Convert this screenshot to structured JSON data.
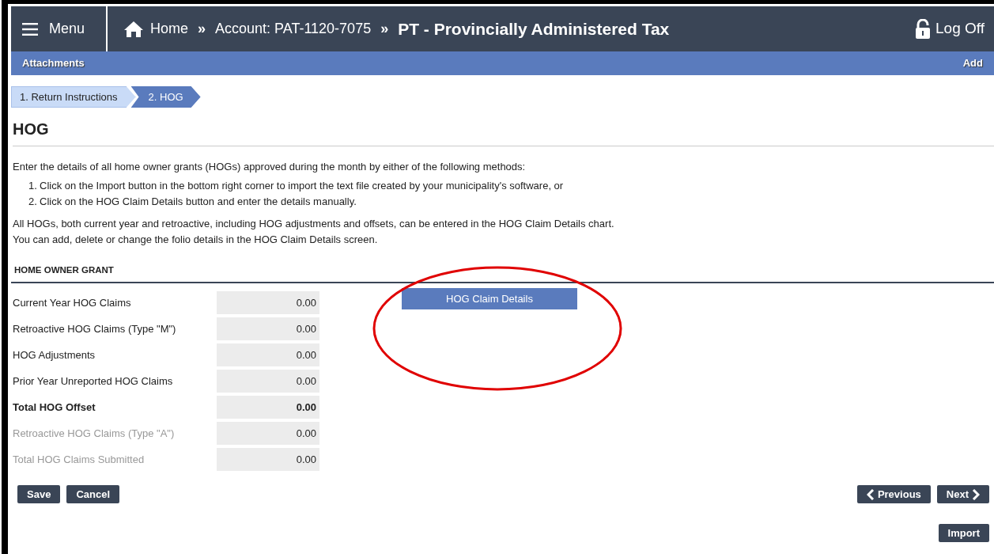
{
  "header": {
    "menu": "Menu",
    "breadcrumbs": [
      {
        "label": "Home",
        "kind": "home"
      },
      {
        "label": "Account: PAT-1120-7075",
        "kind": "link"
      },
      {
        "label": "PT - Provincially Administered Tax",
        "kind": "current"
      }
    ],
    "separator": "»",
    "log_off": "Log Off"
  },
  "attachments_bar": {
    "title": "Attachments",
    "action": "Add"
  },
  "steps": [
    {
      "label": "1. Return Instructions",
      "selected": false
    },
    {
      "label": "2. HOG",
      "selected": true
    }
  ],
  "page_title": "HOG",
  "intro": "Enter the details of all home owner grants (HOGs) approved during the month by either of the following methods:",
  "methods": [
    {
      "number": "1.",
      "text": "Click on the Import button in the bottom right corner to import the text file created by your municipality's software, or"
    },
    {
      "number": "2.",
      "text": "Click on the HOG Claim Details button and enter the details manually."
    }
  ],
  "notes": [
    "All HOGs, both current year and retroactive, including HOG adjustments and offsets, can be entered in the HOG Claim Details chart.",
    "You can add, delete or change the folio details in the HOG Claim Details screen."
  ],
  "section_title": "HOME OWNER GRANT",
  "rows": [
    {
      "label": "Current Year HOG Claims",
      "value": "0.00",
      "kind": "normal"
    },
    {
      "label": "Retroactive HOG Claims (Type \"M\")",
      "value": "0.00",
      "kind": "normal"
    },
    {
      "label": "HOG Adjustments",
      "value": "0.00",
      "kind": "normal"
    },
    {
      "label": "Prior Year Unreported HOG Claims",
      "value": "0.00",
      "kind": "normal"
    },
    {
      "label": "Total HOG Offset",
      "value": "0.00",
      "kind": "total"
    },
    {
      "label": "Retroactive HOG Claims (Type \"A\")",
      "value": "0.00",
      "kind": "muted"
    },
    {
      "label": "Total HOG Claims Submitted",
      "value": "0.00",
      "kind": "muted"
    }
  ],
  "details_button": "HOG Claim Details",
  "highlight": {
    "kind": "ellipse"
  },
  "buttons_left": [
    "Save",
    "Cancel"
  ],
  "previous": "Previous",
  "next": "Next",
  "import": "Import"
}
